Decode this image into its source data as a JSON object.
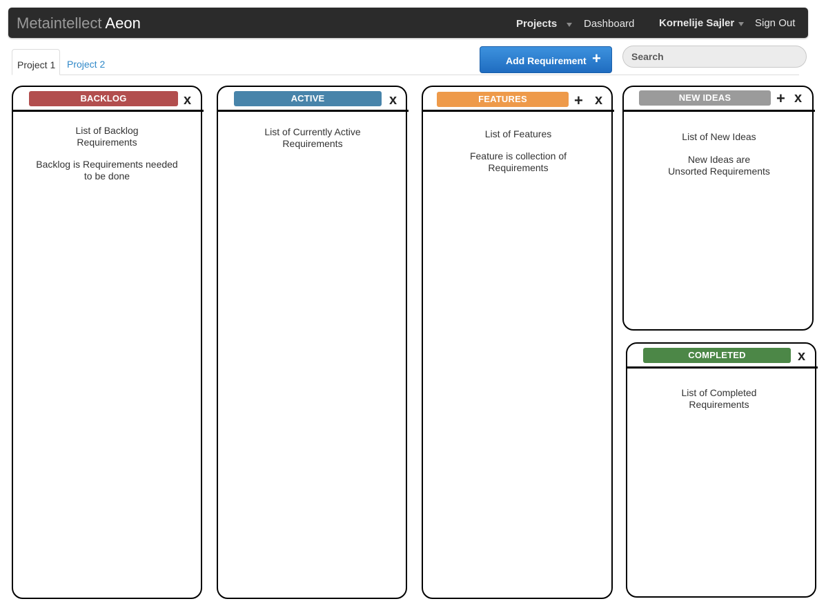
{
  "navbar": {
    "brand_light": "Metaintellect",
    "brand_strong": "Aeon",
    "projects_label": "Projects",
    "dashboard_label": "Dashboard",
    "user_label": "Kornelije Sajler",
    "signout_label": "Sign Out"
  },
  "tabs": [
    {
      "label": "Project 1",
      "active": true
    },
    {
      "label": "Project 2",
      "active": false
    }
  ],
  "toolbar": {
    "add_label": "Add Requirement",
    "add_icon": "+",
    "search_placeholder": "Search"
  },
  "columns": {
    "backlog": {
      "title": "BACKLOG",
      "color": "#b24e4e",
      "close": "x",
      "text1": "List of Backlog\nRequirements",
      "text2": "Backlog is Requirements needed\nto be done"
    },
    "active": {
      "title": "ACTIVE",
      "color": "#4884aa",
      "close": "x",
      "text1": "List of Currently Active\nRequirements"
    },
    "features": {
      "title": "FEATURES",
      "color": "#ee9a4a",
      "add": "+",
      "close": "x",
      "text1": "List of Features",
      "text2": "Feature is collection of\nRequirements"
    },
    "new_ideas": {
      "title": "NEW IDEAS",
      "color": "#9b9b9b",
      "add": "+",
      "close": "x",
      "text1": "List of New Ideas",
      "text2": "New Ideas are\nUnsorted Requirements"
    },
    "completed": {
      "title": "COMPLETED",
      "color": "#4c8747",
      "close": "x",
      "text1": "List of Completed\nRequirements"
    }
  }
}
